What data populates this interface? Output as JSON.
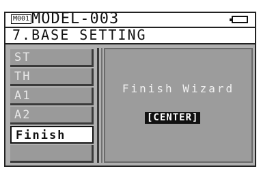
{
  "header": {
    "model_badge": "M001",
    "model_name": "MODEL-003",
    "screen_title": "7.BASE SETTING"
  },
  "menu": {
    "items": [
      {
        "label": "ST"
      },
      {
        "label": "TH"
      },
      {
        "label": "A1"
      },
      {
        "label": "A2"
      },
      {
        "label": "Finish"
      },
      {
        "label": ""
      }
    ],
    "selected_index": 4
  },
  "panel": {
    "title": "Finish Wizard",
    "key_hint": "[CENTER]"
  },
  "colors": {
    "lcd_background": "#b0b0b0",
    "selected_item": "#ffffff",
    "unselected_item": "#9a9a9a",
    "key_badge": "#111111"
  },
  "icons": {
    "battery": "battery-icon"
  }
}
